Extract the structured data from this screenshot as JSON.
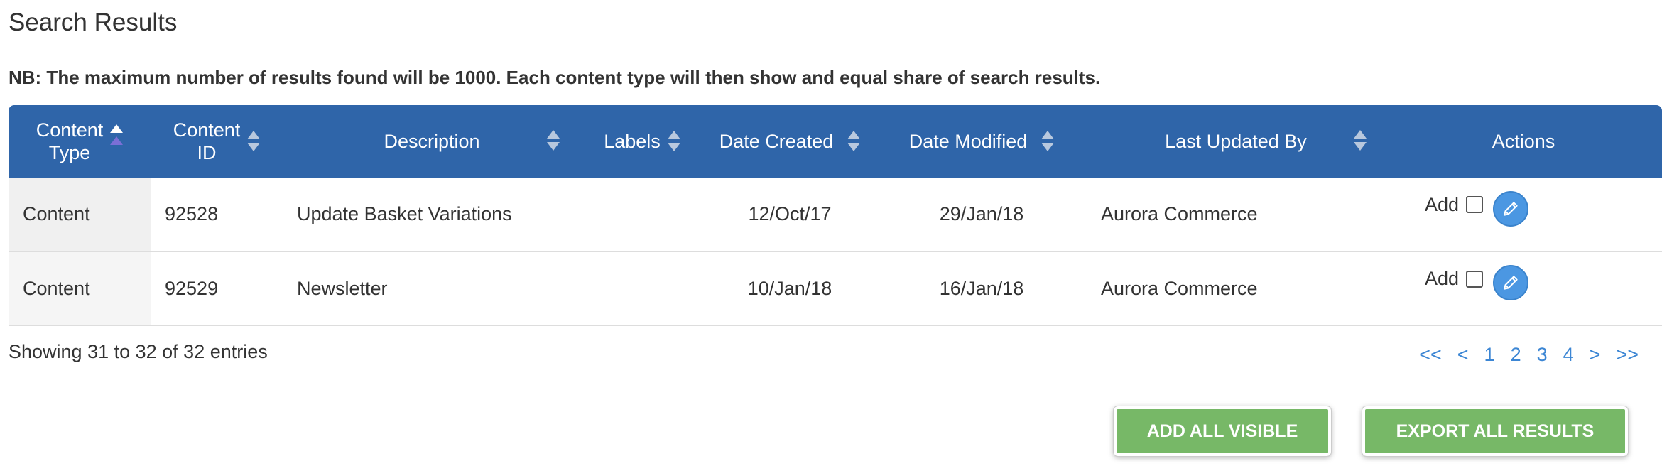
{
  "page": {
    "title": "Search Results",
    "note": "NB: The maximum number of results found will be 1000. Each content type will then show and equal share of search results."
  },
  "table": {
    "columns": [
      {
        "label_line1": "Content",
        "label_line2": "Type"
      },
      {
        "label_line1": "Content",
        "label_line2": "ID"
      },
      {
        "label": "Description"
      },
      {
        "label": "Labels"
      },
      {
        "label": "Date Created"
      },
      {
        "label": "Date Modified"
      },
      {
        "label": "Last Updated By"
      },
      {
        "label": "Actions"
      }
    ],
    "rows": [
      {
        "type": "Content",
        "id": "92528",
        "description": "Update Basket Variations",
        "labels": "",
        "created": "12/Oct/17",
        "modified": "29/Jan/18",
        "updated_by": "Aurora Commerce",
        "add_label": "Add",
        "add_checked": false
      },
      {
        "type": "Content",
        "id": "92529",
        "description": "Newsletter",
        "labels": "",
        "created": "10/Jan/18",
        "modified": "16/Jan/18",
        "updated_by": "Aurora Commerce",
        "add_label": "Add",
        "add_checked": false
      }
    ],
    "sorted_column": "Content Type",
    "sort_direction": "ascending"
  },
  "footer": {
    "info": "Showing 31 to 32 of 32 entries",
    "pager": {
      "first": "<<",
      "prev": "<",
      "pages": [
        "1",
        "2",
        "3",
        "4"
      ],
      "next": ">",
      "last": ">>"
    }
  },
  "buttons": {
    "add_all": "ADD ALL VISIBLE",
    "export": "EXPORT ALL RESULTS"
  },
  "colors": {
    "header_bg": "#2f65a9",
    "button_green": "#77b867",
    "link_blue": "#3c86d4",
    "edit_icon_bg": "#4b97e2"
  },
  "icons": {
    "sort": "sort-arrows-icon",
    "edit": "pencil-icon",
    "checkbox": "checkbox-icon"
  }
}
